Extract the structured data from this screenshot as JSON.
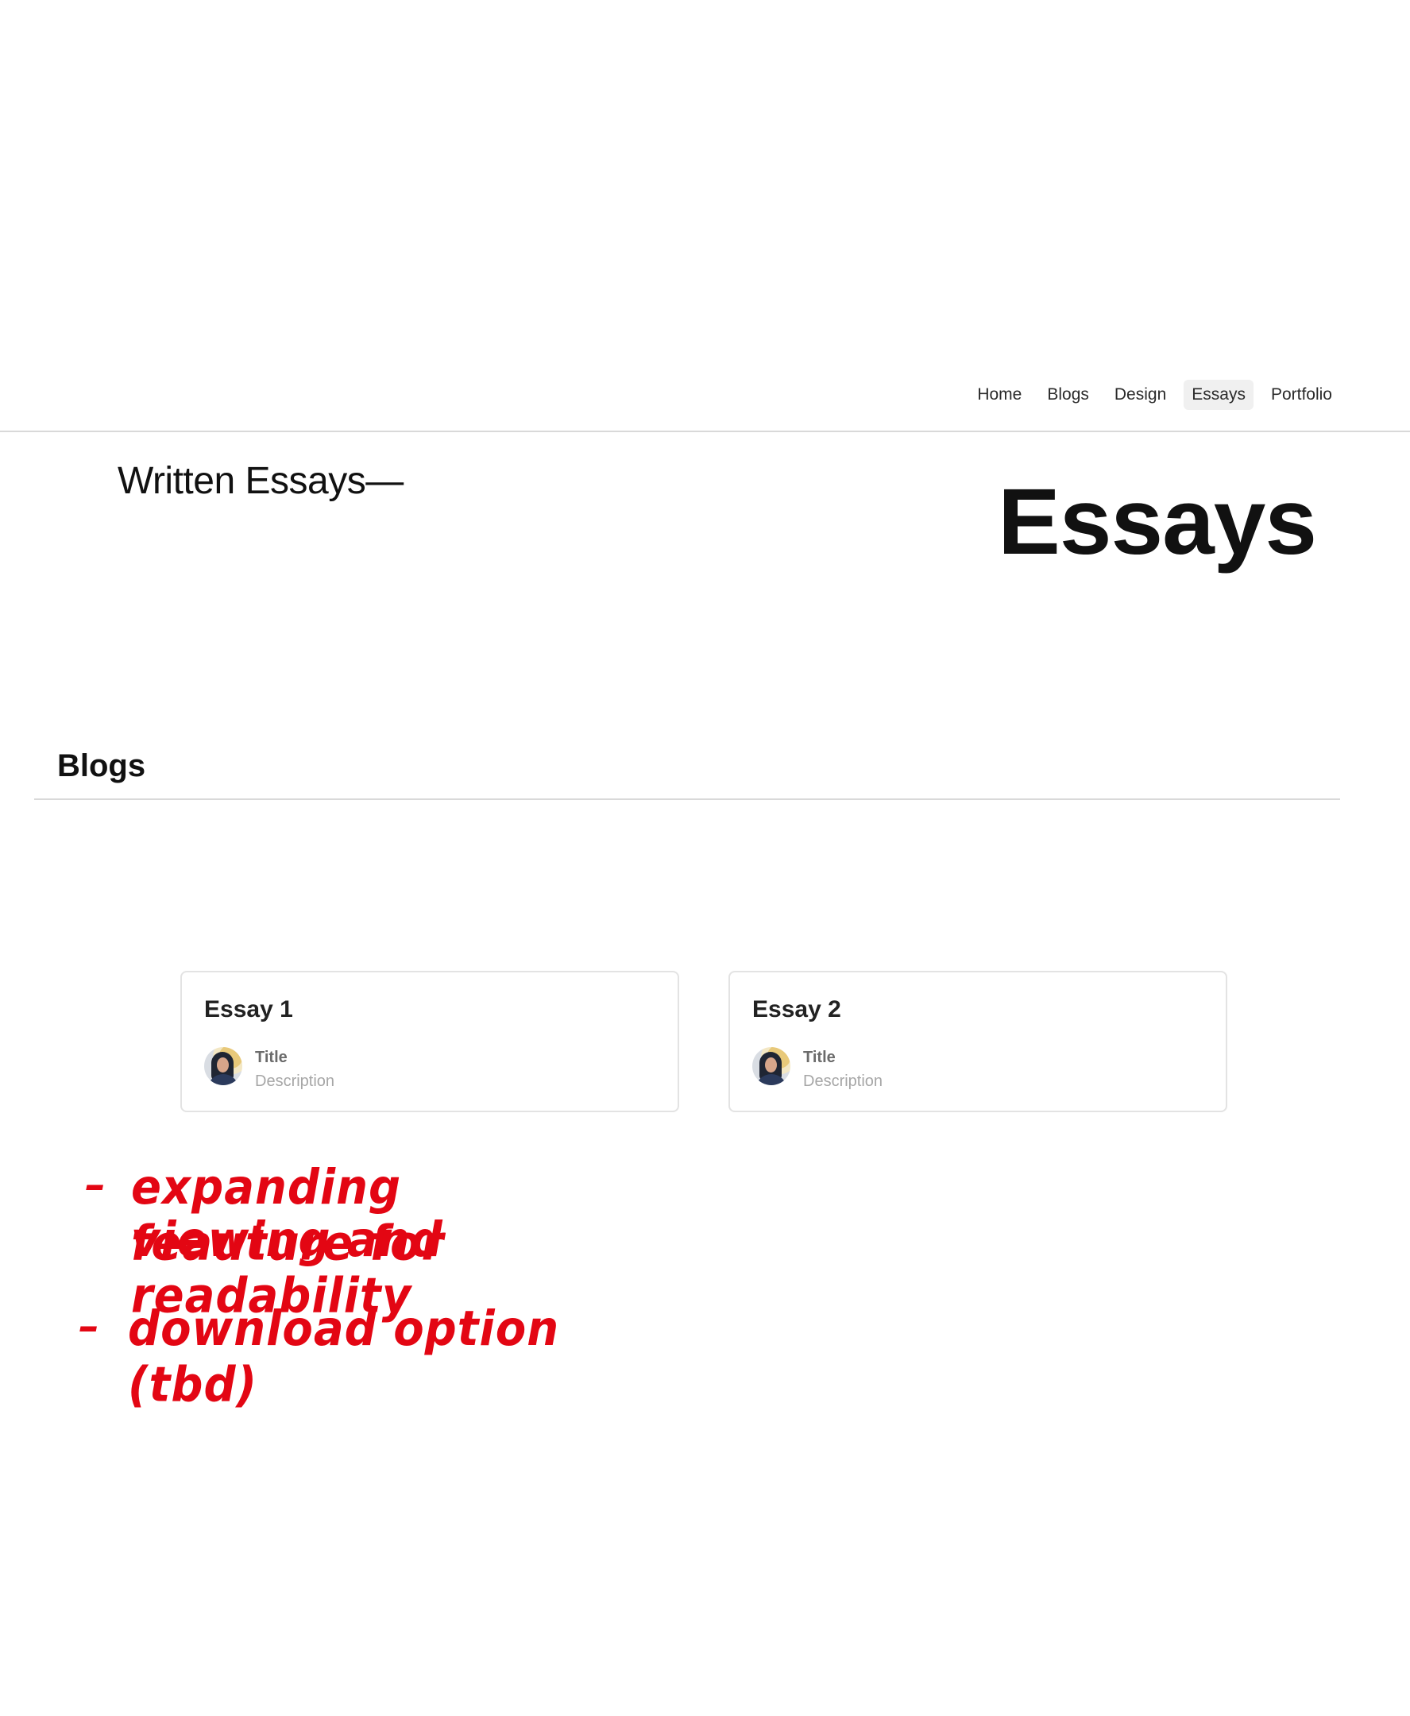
{
  "nav": {
    "items": [
      {
        "label": "Home"
      },
      {
        "label": "Blogs"
      },
      {
        "label": "Design"
      },
      {
        "label": "Essays",
        "active": true
      },
      {
        "label": "Portfolio"
      }
    ]
  },
  "header": {
    "written_label": "Written Essays—",
    "hero_title": "Essays"
  },
  "section": {
    "title": "Blogs"
  },
  "cards": [
    {
      "title": "Essay 1",
      "meta_title": "Title",
      "meta_desc": "Description"
    },
    {
      "title": "Essay 2",
      "meta_title": "Title",
      "meta_desc": "Description"
    }
  ],
  "annotations": {
    "color": "#e30613",
    "line1": "expanding feauture for",
    "line2": "viewing and readability",
    "line3": "download option (tbd)"
  }
}
